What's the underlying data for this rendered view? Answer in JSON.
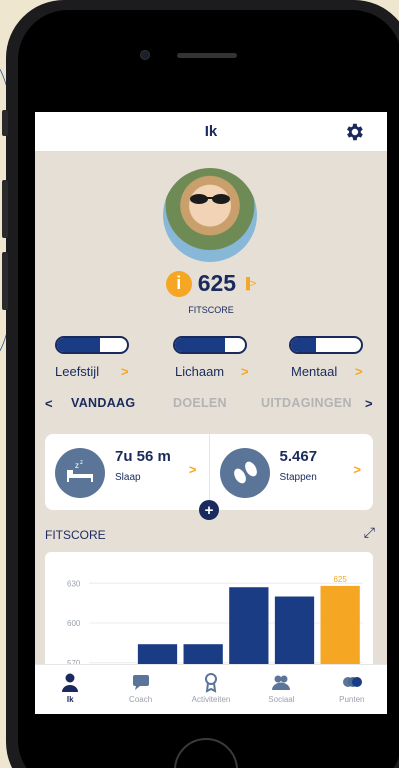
{
  "header": {
    "title": "Ik"
  },
  "score": {
    "badge": "i",
    "value": "625",
    "mini": "▐>",
    "label": "FITSCORE"
  },
  "categories": [
    {
      "label": "Leefstijl",
      "fill": 0.62
    },
    {
      "label": "Lichaam",
      "fill": 0.72
    },
    {
      "label": "Mentaal",
      "fill": 0.35
    }
  ],
  "tabs": {
    "prev": "<",
    "items": [
      "VANDAAG",
      "DOELEN",
      "UITDAGINGEN"
    ],
    "next": ">"
  },
  "cards": [
    {
      "value": "7u 56 m",
      "label": "Slaap",
      "icon": "bed-icon"
    },
    {
      "value": "5.467",
      "label": "Stappen",
      "icon": "footsteps-icon"
    }
  ],
  "plus": "+",
  "fitscore_section": {
    "label": "FITSCORE"
  },
  "chart_data": {
    "type": "bar",
    "yticks": [
      "630",
      "600",
      "570"
    ],
    "ylim": [
      560,
      640
    ],
    "values": [
      565,
      584,
      584,
      627,
      620,
      628
    ],
    "highlight_index": 5,
    "highlight_label": "625",
    "colors": {
      "bar": "#1a3c84",
      "highlight": "#f5a623"
    }
  },
  "tabbar": [
    {
      "label": "Ik",
      "icon": "person-icon",
      "active": true
    },
    {
      "label": "Coach",
      "icon": "chat-icon"
    },
    {
      "label": "Activiteiten",
      "icon": "medal-icon"
    },
    {
      "label": "Sociaal",
      "icon": "group-icon"
    },
    {
      "label": "Punten",
      "icon": "coins-icon"
    }
  ],
  "colors": {
    "navy": "#1a2a5c",
    "orange": "#f5a623",
    "bar": "#1a3c84"
  }
}
